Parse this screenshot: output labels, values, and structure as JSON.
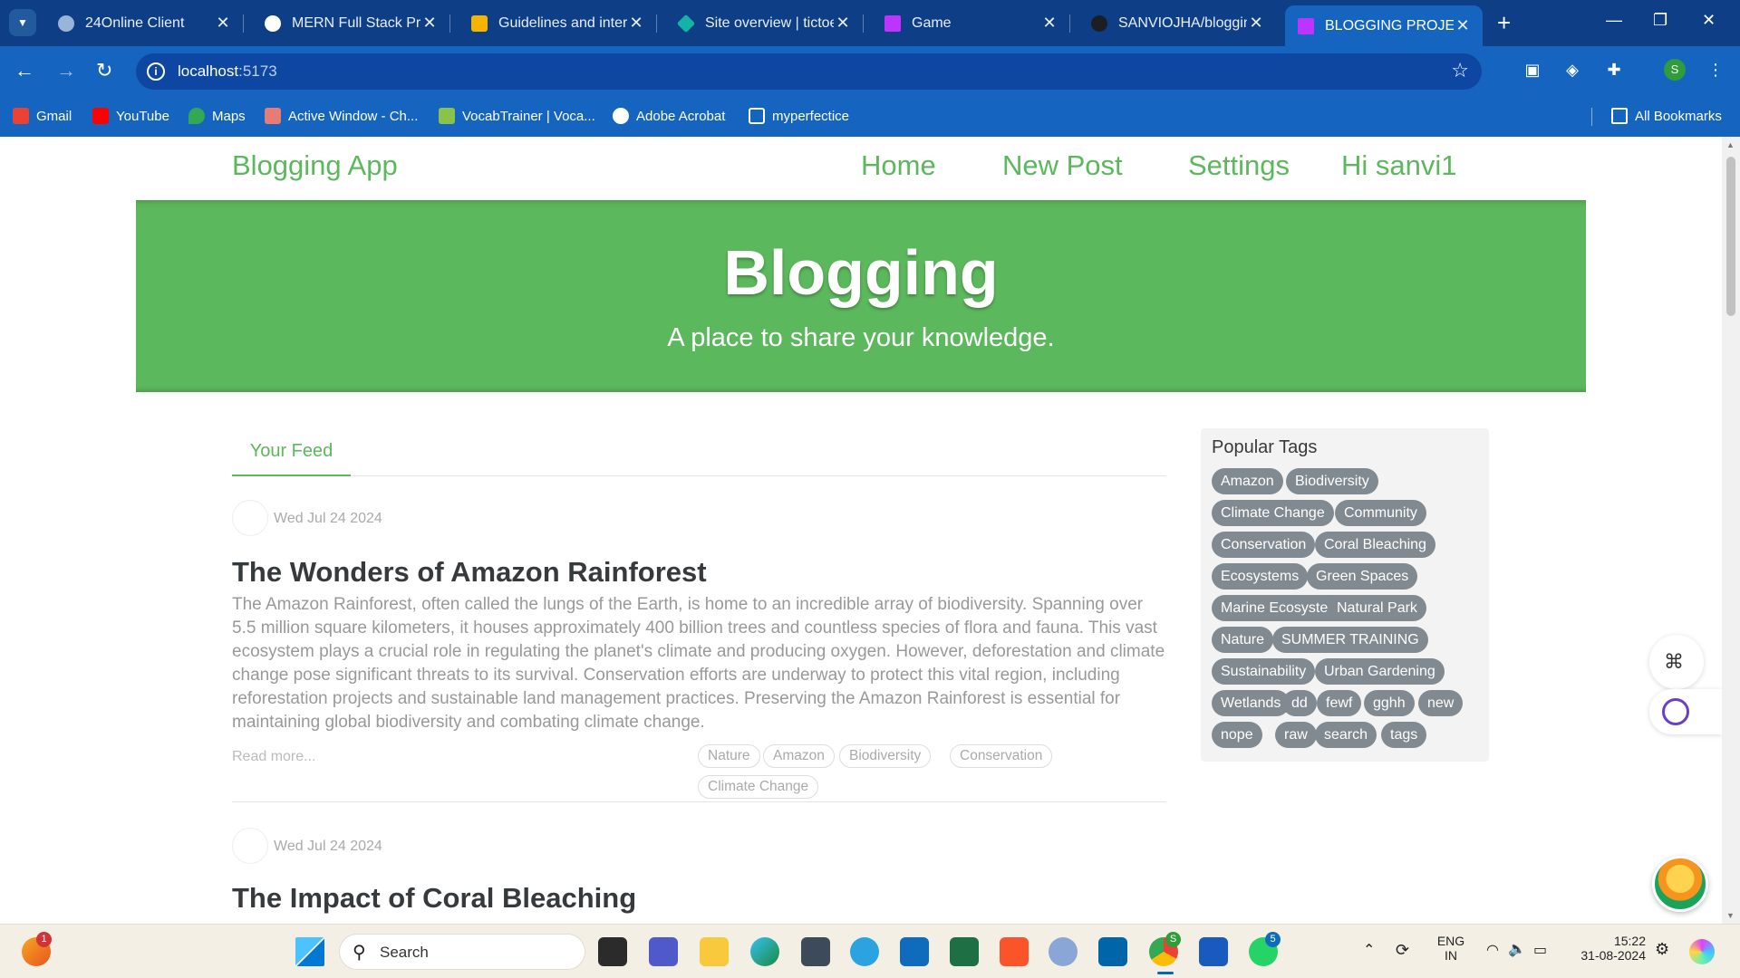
{
  "browser": {
    "tabs": [
      {
        "title": "24Online Client",
        "active": false,
        "fav_color": "#9ab4d8"
      },
      {
        "title": "MERN Full Stack Proj",
        "active": false,
        "fav_color": "#ffffff"
      },
      {
        "title": "Guidelines and interf",
        "active": false,
        "fav_color": "#f4b400"
      },
      {
        "title": "Site overview | tictoe",
        "active": false,
        "fav_color": "#12b5a5"
      },
      {
        "title": "Game",
        "active": false,
        "fav_color": "#bd34fe"
      },
      {
        "title": "SANVIOJHA/bloggin",
        "active": false,
        "fav_color": "#1b1f24"
      },
      {
        "title": "BLOGGING PROJECT",
        "active": true,
        "fav_color": "#bd34fe"
      }
    ],
    "new_tab_label": "+",
    "url_host": "localhost",
    "url_port": ":5173",
    "profile_initial": "S",
    "bookmarks": [
      {
        "label": "Gmail",
        "icon": "gmail-icon",
        "color": "#ea4335"
      },
      {
        "label": "YouTube",
        "icon": "youtube-icon",
        "color": "#ff0000"
      },
      {
        "label": "Maps",
        "icon": "maps-icon",
        "color": "#34a853"
      },
      {
        "label": "Active Window - Ch...",
        "icon": "app-icon",
        "color": "#e67c73"
      },
      {
        "label": "VocabTrainer | Voca...",
        "icon": "check-icon",
        "color": "#8bc34a"
      },
      {
        "label": "Adobe Acrobat",
        "icon": "globe-icon",
        "color": "#ffffff"
      },
      {
        "label": "myperfectice",
        "icon": "link-icon",
        "color": "#ffffff"
      }
    ],
    "all_bookmarks_label": "All Bookmarks"
  },
  "app": {
    "brand": "Blogging App",
    "nav": [
      "Home",
      "New Post",
      "Settings",
      "Hi sanvi1"
    ],
    "banner_title": "Blogging",
    "banner_subtitle": "A place to share your knowledge.",
    "feed_tab": "Your Feed",
    "read_more": "Read more...",
    "articles": [
      {
        "date": "Wed Jul 24 2024",
        "title": "The Wonders of Amazon Rainforest",
        "description": "The Amazon Rainforest, often called the lungs of the Earth, is home to an incredible array of biodiversity. Spanning over 5.5 million square kilometers, it houses approximately 400 billion trees and countless species of flora and fauna. This vast ecosystem plays a crucial role in regulating the planet's climate and producing oxygen. However, deforestation and climate change pose significant threats to its survival. Conservation efforts are underway to protect this vital region, including reforestation projects and sustainable land management practices. Preserving the Amazon Rainforest is essential for maintaining global biodiversity and combating climate change.",
        "tags": [
          "Nature",
          "Amazon",
          "Biodiversity",
          "Conservation",
          "Climate Change"
        ]
      },
      {
        "date": "Wed Jul 24 2024",
        "title": "The Impact of Coral Bleaching"
      }
    ],
    "popular_tags_title": "Popular Tags",
    "popular_tags": [
      "Amazon",
      "Biodiversity",
      "Climate Change",
      "Community",
      "Conservation",
      "Coral Bleaching",
      "Ecosystems",
      "Green Spaces",
      "Marine Ecosystems",
      "Natural Park",
      "Nature",
      "SUMMER TRAINING",
      "Sustainability",
      "Urban Gardening",
      "Wetlands",
      "dd",
      "fewf",
      "gghh",
      "new",
      "nope",
      "raw",
      "search",
      "tags"
    ],
    "accent_color": "#5cb85c"
  },
  "taskbar": {
    "search_label": "Search",
    "tray_lang_1": "ENG",
    "tray_lang_2": "IN",
    "time": "15:22",
    "date": "31-08-2024",
    "notification_count": "1",
    "chrome_badge": "S",
    "whatsapp_badge": "5"
  }
}
